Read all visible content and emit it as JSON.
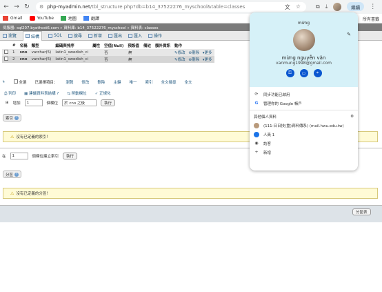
{
  "browser": {
    "url_host": "php-myadmin.net",
    "url_path": "/tbl_structure.php?db=b14_37522276_myschool&table=classes",
    "profile_label": "繼續",
    "bookmarks": [
      "Gmail",
      "YouTube",
      "地圖",
      "翻譯"
    ],
    "all_bookmarks": "所有書籤"
  },
  "pma": {
    "breadcrumb": "伺服器: sql207.byethost6.com » 資料庫: b14_37522276_myschool » 資料表: classes",
    "tabs": [
      "瀏覽",
      "結構",
      "SQL",
      "搜尋",
      "新增",
      "匯出",
      "匯入",
      "操作"
    ],
    "table": {
      "headers": [
        "#",
        "名稱",
        "類型",
        "編碼與排序",
        "屬性",
        "空值(Null)",
        "預設值",
        "備註",
        "額外資訊",
        "動作"
      ],
      "rows": [
        {
          "num": "1",
          "name": "sno",
          "type": "varchar(5)",
          "collation": "latin1_swedish_ci",
          "null": "否",
          "default": "無",
          "edit": "修改",
          "drop": "刪除",
          "more": "更多"
        },
        {
          "num": "2",
          "name": "cno",
          "type": "varchar(5)",
          "collation": "latin1_swedish_ci",
          "null": "否",
          "default": "無",
          "edit": "修改",
          "drop": "刪除",
          "more": "更多"
        }
      ]
    },
    "selection": {
      "check_all": "全選",
      "with_selected": "已選擇項目：",
      "actions": [
        "瀏覽",
        "修改",
        "刪除",
        "主鍵",
        "唯一",
        "索引",
        "全文搜尋",
        "全文"
      ]
    },
    "tools": [
      "列印",
      "建議資料表結構",
      "移動欄位",
      "正規化"
    ],
    "add_column": {
      "label_pre": "增加",
      "count": "1",
      "label_mid": "個欄位",
      "position": "於 cno 之後",
      "button": "執行"
    },
    "indexes": {
      "legend": "索引",
      "notice": "沒有已定義的索引！",
      "create_pre": "在",
      "create_count": "1",
      "create_label": "個欄位建立索引",
      "create_button": "執行"
    },
    "partitions": {
      "legend": "分區",
      "notice": "沒有已定義的分區！",
      "button": "分區表"
    }
  },
  "profile_popup": {
    "top_name": "mừng",
    "full_name": "mừng nguyễn văn",
    "email": "vanmung1998@gmail.com",
    "sync": "同步功能已啟用",
    "manage": "管理你的 Google 帳戶",
    "other_profiles": "其他個人資料",
    "profile_item": "(111-日日技(重)資料傳系) (mail.hwu.edu.tw)",
    "person1": "人員 1",
    "guest": "訪客",
    "add": "新增"
  }
}
